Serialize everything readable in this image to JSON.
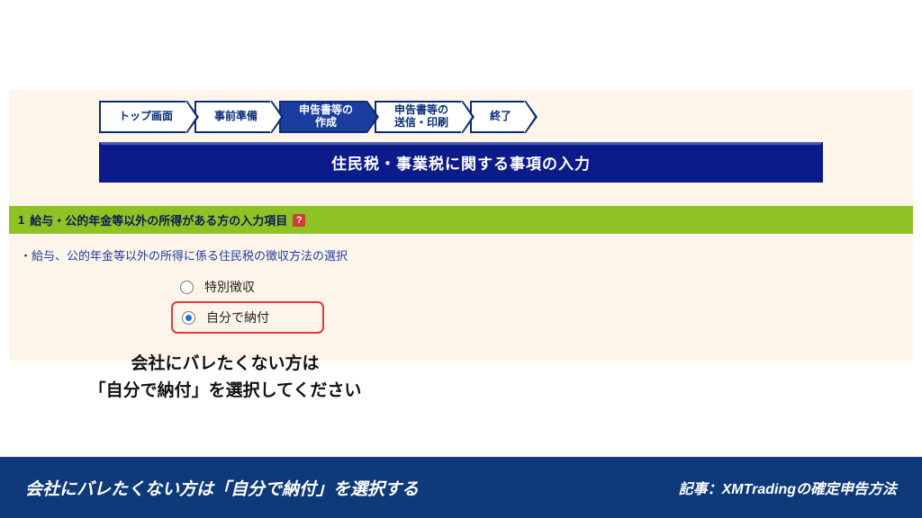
{
  "breadcrumb": {
    "steps": [
      {
        "label": "トップ画面",
        "active": false
      },
      {
        "label": "事前準備",
        "active": false
      },
      {
        "label": "申告書等の\n作成",
        "active": true
      },
      {
        "label": "申告書等の\n送信・印刷",
        "active": false
      },
      {
        "label": "終了",
        "active": false
      }
    ]
  },
  "page_title": "住民税・事業税に関する事項の入力",
  "section": {
    "number": "1",
    "title": "給与・公的年金等以外の所得がある方の入力項目",
    "help": "?"
  },
  "instruction": "・給与、公的年金等以外の所得に係る住民税の徴収方法の選択",
  "options": {
    "tokubetsu": "特別徴収",
    "jibun": "自分で納付"
  },
  "explain": {
    "line1": "会社にバレたくない方は",
    "line2": "「自分で納付」を選択してください"
  },
  "footer": {
    "left": "会社にバレたくない方は「自分で納付」を選択する",
    "right": "記事：XMTradingの確定申告方法"
  }
}
